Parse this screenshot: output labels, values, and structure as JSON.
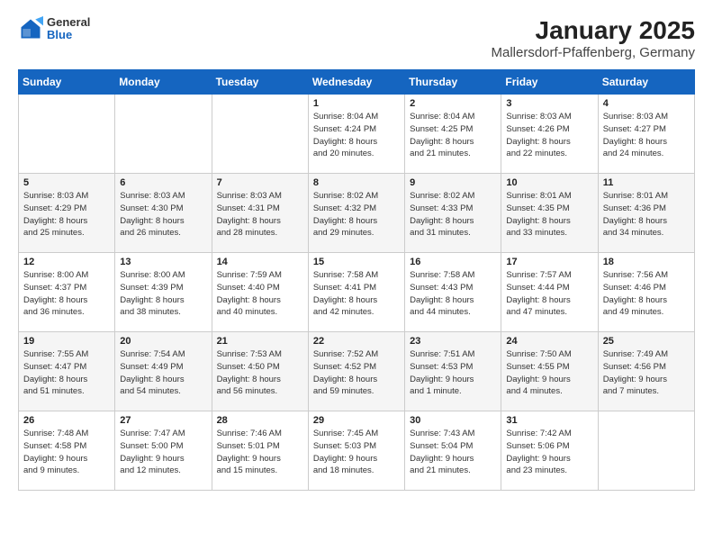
{
  "logo": {
    "general": "General",
    "blue": "Blue"
  },
  "title": "January 2025",
  "subtitle": "Mallersdorf-Pfaffenberg, Germany",
  "weekdays": [
    "Sunday",
    "Monday",
    "Tuesday",
    "Wednesday",
    "Thursday",
    "Friday",
    "Saturday"
  ],
  "weeks": [
    [
      {
        "day": "",
        "info": ""
      },
      {
        "day": "",
        "info": ""
      },
      {
        "day": "",
        "info": ""
      },
      {
        "day": "1",
        "info": "Sunrise: 8:04 AM\nSunset: 4:24 PM\nDaylight: 8 hours\nand 20 minutes."
      },
      {
        "day": "2",
        "info": "Sunrise: 8:04 AM\nSunset: 4:25 PM\nDaylight: 8 hours\nand 21 minutes."
      },
      {
        "day": "3",
        "info": "Sunrise: 8:03 AM\nSunset: 4:26 PM\nDaylight: 8 hours\nand 22 minutes."
      },
      {
        "day": "4",
        "info": "Sunrise: 8:03 AM\nSunset: 4:27 PM\nDaylight: 8 hours\nand 24 minutes."
      }
    ],
    [
      {
        "day": "5",
        "info": "Sunrise: 8:03 AM\nSunset: 4:29 PM\nDaylight: 8 hours\nand 25 minutes."
      },
      {
        "day": "6",
        "info": "Sunrise: 8:03 AM\nSunset: 4:30 PM\nDaylight: 8 hours\nand 26 minutes."
      },
      {
        "day": "7",
        "info": "Sunrise: 8:03 AM\nSunset: 4:31 PM\nDaylight: 8 hours\nand 28 minutes."
      },
      {
        "day": "8",
        "info": "Sunrise: 8:02 AM\nSunset: 4:32 PM\nDaylight: 8 hours\nand 29 minutes."
      },
      {
        "day": "9",
        "info": "Sunrise: 8:02 AM\nSunset: 4:33 PM\nDaylight: 8 hours\nand 31 minutes."
      },
      {
        "day": "10",
        "info": "Sunrise: 8:01 AM\nSunset: 4:35 PM\nDaylight: 8 hours\nand 33 minutes."
      },
      {
        "day": "11",
        "info": "Sunrise: 8:01 AM\nSunset: 4:36 PM\nDaylight: 8 hours\nand 34 minutes."
      }
    ],
    [
      {
        "day": "12",
        "info": "Sunrise: 8:00 AM\nSunset: 4:37 PM\nDaylight: 8 hours\nand 36 minutes."
      },
      {
        "day": "13",
        "info": "Sunrise: 8:00 AM\nSunset: 4:39 PM\nDaylight: 8 hours\nand 38 minutes."
      },
      {
        "day": "14",
        "info": "Sunrise: 7:59 AM\nSunset: 4:40 PM\nDaylight: 8 hours\nand 40 minutes."
      },
      {
        "day": "15",
        "info": "Sunrise: 7:58 AM\nSunset: 4:41 PM\nDaylight: 8 hours\nand 42 minutes."
      },
      {
        "day": "16",
        "info": "Sunrise: 7:58 AM\nSunset: 4:43 PM\nDaylight: 8 hours\nand 44 minutes."
      },
      {
        "day": "17",
        "info": "Sunrise: 7:57 AM\nSunset: 4:44 PM\nDaylight: 8 hours\nand 47 minutes."
      },
      {
        "day": "18",
        "info": "Sunrise: 7:56 AM\nSunset: 4:46 PM\nDaylight: 8 hours\nand 49 minutes."
      }
    ],
    [
      {
        "day": "19",
        "info": "Sunrise: 7:55 AM\nSunset: 4:47 PM\nDaylight: 8 hours\nand 51 minutes."
      },
      {
        "day": "20",
        "info": "Sunrise: 7:54 AM\nSunset: 4:49 PM\nDaylight: 8 hours\nand 54 minutes."
      },
      {
        "day": "21",
        "info": "Sunrise: 7:53 AM\nSunset: 4:50 PM\nDaylight: 8 hours\nand 56 minutes."
      },
      {
        "day": "22",
        "info": "Sunrise: 7:52 AM\nSunset: 4:52 PM\nDaylight: 8 hours\nand 59 minutes."
      },
      {
        "day": "23",
        "info": "Sunrise: 7:51 AM\nSunset: 4:53 PM\nDaylight: 9 hours\nand 1 minute."
      },
      {
        "day": "24",
        "info": "Sunrise: 7:50 AM\nSunset: 4:55 PM\nDaylight: 9 hours\nand 4 minutes."
      },
      {
        "day": "25",
        "info": "Sunrise: 7:49 AM\nSunset: 4:56 PM\nDaylight: 9 hours\nand 7 minutes."
      }
    ],
    [
      {
        "day": "26",
        "info": "Sunrise: 7:48 AM\nSunset: 4:58 PM\nDaylight: 9 hours\nand 9 minutes."
      },
      {
        "day": "27",
        "info": "Sunrise: 7:47 AM\nSunset: 5:00 PM\nDaylight: 9 hours\nand 12 minutes."
      },
      {
        "day": "28",
        "info": "Sunrise: 7:46 AM\nSunset: 5:01 PM\nDaylight: 9 hours\nand 15 minutes."
      },
      {
        "day": "29",
        "info": "Sunrise: 7:45 AM\nSunset: 5:03 PM\nDaylight: 9 hours\nand 18 minutes."
      },
      {
        "day": "30",
        "info": "Sunrise: 7:43 AM\nSunset: 5:04 PM\nDaylight: 9 hours\nand 21 minutes."
      },
      {
        "day": "31",
        "info": "Sunrise: 7:42 AM\nSunset: 5:06 PM\nDaylight: 9 hours\nand 23 minutes."
      },
      {
        "day": "",
        "info": ""
      }
    ]
  ]
}
